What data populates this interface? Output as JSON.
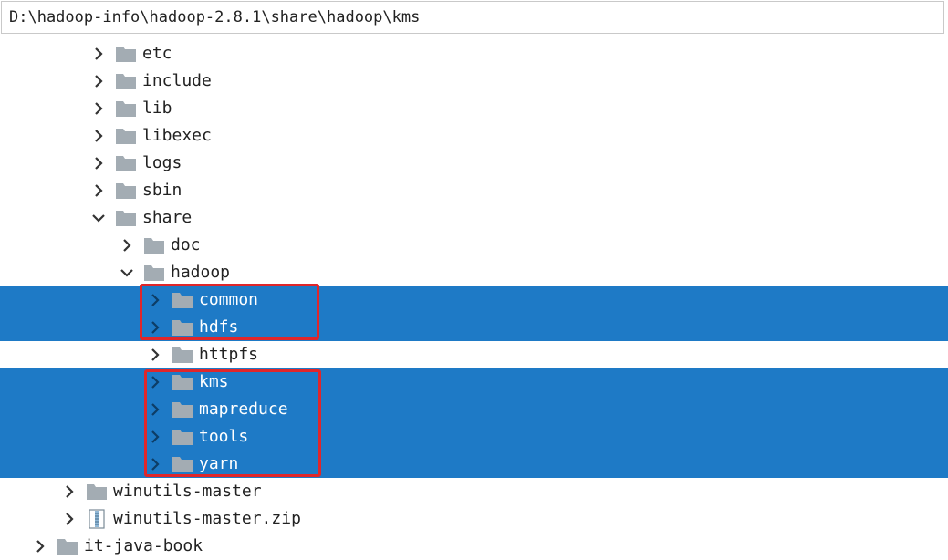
{
  "path_bar": {
    "value": "D:\\hadoop-info\\hadoop-2.8.1\\share\\hadoop\\kms"
  },
  "colors": {
    "selection": "#1e7ac6",
    "highlight_box": "#e0262a",
    "folder": "#a3acb3"
  },
  "tree": {
    "items": [
      {
        "label": "etc",
        "state": "collapsed",
        "icon": "folder-icon"
      },
      {
        "label": "include",
        "state": "collapsed",
        "icon": "folder-icon"
      },
      {
        "label": "lib",
        "state": "collapsed",
        "icon": "folder-icon"
      },
      {
        "label": "libexec",
        "state": "collapsed",
        "icon": "folder-icon"
      },
      {
        "label": "logs",
        "state": "collapsed",
        "icon": "folder-icon"
      },
      {
        "label": "sbin",
        "state": "collapsed",
        "icon": "folder-icon"
      },
      {
        "label": "share",
        "state": "expanded",
        "icon": "folder-icon"
      },
      {
        "label": "doc",
        "state": "collapsed",
        "icon": "folder-icon"
      },
      {
        "label": "hadoop",
        "state": "expanded",
        "icon": "folder-icon"
      },
      {
        "label": "common",
        "state": "collapsed",
        "icon": "folder-icon",
        "selected": true
      },
      {
        "label": "hdfs",
        "state": "collapsed",
        "icon": "folder-icon",
        "selected": true
      },
      {
        "label": "httpfs",
        "state": "collapsed",
        "icon": "folder-icon"
      },
      {
        "label": "kms",
        "state": "collapsed",
        "icon": "folder-icon",
        "selected": true
      },
      {
        "label": "mapreduce",
        "state": "collapsed",
        "icon": "folder-icon",
        "selected": true
      },
      {
        "label": "tools",
        "state": "collapsed",
        "icon": "folder-icon",
        "selected": true
      },
      {
        "label": "yarn",
        "state": "collapsed",
        "icon": "folder-icon",
        "selected": true
      },
      {
        "label": "winutils-master",
        "state": "collapsed",
        "icon": "folder-icon"
      },
      {
        "label": "winutils-master.zip",
        "state": "collapsed",
        "icon": "zip-file-icon"
      },
      {
        "label": "it-java-book",
        "state": "collapsed",
        "icon": "folder-icon"
      }
    ]
  }
}
